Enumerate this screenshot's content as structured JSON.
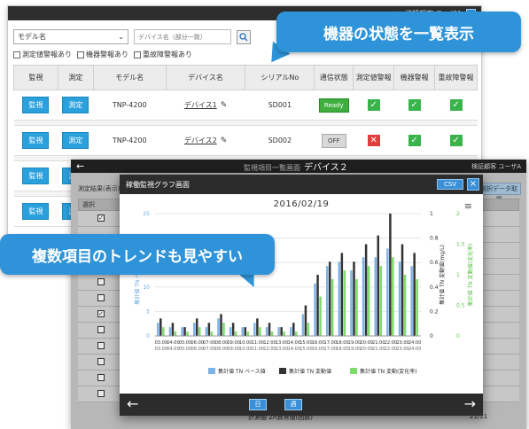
{
  "back_window": {
    "user_label": "検証顧客 ユーザA",
    "model_select": "モデル名",
    "device_placeholder": "デバイス名（部分一致）",
    "checks": [
      "測定値警報あり",
      "機器警報あり",
      "重故障警報あり"
    ],
    "columns": [
      "監視",
      "測定",
      "モデル名",
      "デバイス名",
      "シリアルNo",
      "通信状態",
      "測定値警報",
      "機器警報",
      "重故障警報"
    ],
    "rows": [
      {
        "monitor": "監視",
        "measure": "測定",
        "model": "TNP-4200",
        "device": "デバイス1",
        "serial": "SD001",
        "comm": "Ready"
      },
      {
        "monitor": "監視",
        "measure": "測定",
        "model": "TNP-4200",
        "device": "デバイス2",
        "serial": "SD002",
        "comm": "OFF"
      },
      {
        "monitor": "監視",
        "measure": "測定"
      },
      {
        "monitor": "監視",
        "measure": "測定"
      }
    ]
  },
  "callouts": {
    "top": "機器の状態を一覧表示",
    "middle": "複数項目のトレンドも見やすい"
  },
  "mid_window": {
    "back_arrow": "←",
    "crumb": "監視項目一覧画面",
    "device": "デバイス２",
    "user": "検証顧客 ユーザA",
    "label": "測定結果(表示)",
    "right_button": "選択データ取得",
    "select_header": "選択",
    "bottom_text": "計測値 Zn異常値(回数)",
    "bottom_value": "21/21"
  },
  "modal": {
    "title": "稼働監視グラフ画面",
    "csv": "CSV",
    "close": "×",
    "date": "2016/02/19",
    "menu": "≡",
    "prev": "←",
    "next": "→",
    "btn_day": "日",
    "btn_week": "週"
  },
  "chart_data": {
    "type": "bar",
    "title": "",
    "categories": [
      "03:00",
      "04:00",
      "05:00",
      "06:00",
      "07:00",
      "08:00",
      "09:00",
      "10:00",
      "11:00",
      "12:00",
      "13:00",
      "14:00",
      "15:00",
      "16:00",
      "17:00",
      "18:00",
      "19:00",
      "20:00",
      "21:00",
      "22:00",
      "23:00",
      "24:00"
    ],
    "tick_labels_top": [
      "03:00",
      "04:00",
      "05:00",
      "06:00",
      "07:00",
      "08:00",
      "09:00",
      "10:00",
      "11:00",
      "12:00",
      "13:00",
      "14:00",
      "15:00",
      "16:00",
      "17:00",
      "18:00",
      "19:00",
      "20:00",
      "21:00",
      "22:00",
      "23:00",
      "24:00"
    ],
    "tick_labels_bottom": [
      "03:00",
      "04:00",
      "05:00",
      "06:00",
      "07:00",
      "08:00",
      "09:00",
      "10:00",
      "11:00",
      "12:00",
      "13:00",
      "14:00",
      "15:00",
      "16:00",
      "17:00",
      "18:00",
      "19:00",
      "20:00",
      "21:00",
      "22:00",
      "23:00",
      "24:00"
    ],
    "left_axis_ticks": [
      "0",
      "5",
      "10",
      "15",
      "20",
      "25"
    ],
    "right_axis1_ticks": [
      "0",
      "0.2",
      "0.4",
      "0.6",
      "0.8",
      "1"
    ],
    "right_axis2_ticks": [
      "0",
      "0.5",
      "1",
      "1.5",
      "2"
    ],
    "ylabel_left": "集計値 TN ベース(mg/L)",
    "ylabel_right1": "集計値 TN 変動値(mg/L)",
    "ylabel_right2": "集計値 TN 変動値(変化率)",
    "ylim": [
      0,
      28
    ],
    "series": [
      {
        "name": "集計値 TN ベース値",
        "color": "#7cb3e8",
        "values": [
          3,
          2,
          2,
          3,
          2,
          4,
          2,
          2,
          3,
          2,
          2,
          2,
          5,
          12,
          16,
          17,
          15,
          18,
          18,
          20,
          17,
          16
        ]
      },
      {
        "name": "集計値 TN 変動値",
        "color": "#333333",
        "values": [
          4,
          3,
          2,
          4,
          3,
          5,
          3,
          2,
          4,
          3,
          2,
          3,
          7,
          14,
          17,
          19,
          17,
          21,
          23,
          28,
          21,
          19
        ]
      },
      {
        "name": "集計値 TN 変動(変化率)",
        "color": "#7ddc6a",
        "values": [
          2,
          1,
          1,
          2,
          1,
          3,
          1,
          1,
          2,
          1,
          1,
          1,
          3,
          9,
          13,
          15,
          13,
          16,
          16,
          18,
          14,
          13
        ]
      }
    ],
    "legend_position": "bottom",
    "grid": true
  }
}
